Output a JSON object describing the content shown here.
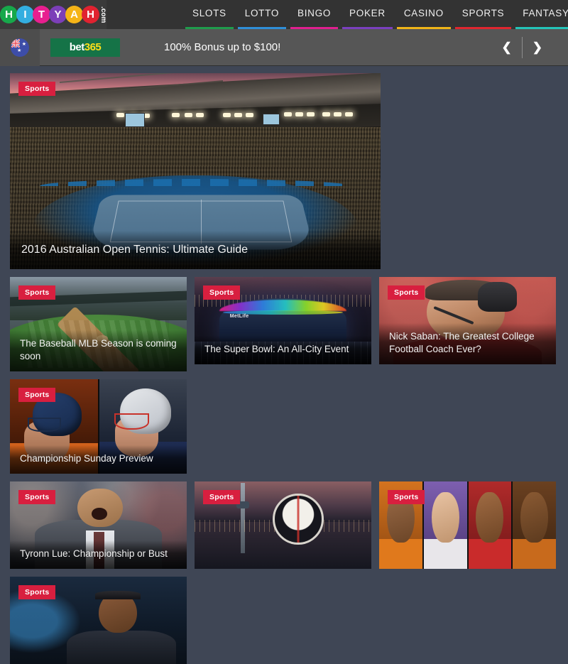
{
  "site": {
    "logo_letters": [
      {
        "char": "H",
        "color": "#17a84b"
      },
      {
        "char": "I",
        "color": "#33aee0"
      },
      {
        "char": "T",
        "color": "#e81f8f"
      },
      {
        "char": "Y",
        "color": "#7c3fb8"
      },
      {
        "char": "A",
        "color": "#f5b417"
      },
      {
        "char": "H",
        "color": "#e02230"
      }
    ],
    "logo_suffix": ".com"
  },
  "nav": {
    "items": [
      {
        "label": "SLOTS",
        "underline": "#1f9c4c"
      },
      {
        "label": "LOTTO",
        "underline": "#2f8fd8"
      },
      {
        "label": "BINGO",
        "underline": "#e01f8f"
      },
      {
        "label": "POKER",
        "underline": "#7a3fbf"
      },
      {
        "label": "CASINO",
        "underline": "#f0b518"
      },
      {
        "label": "SPORTS",
        "underline": "#e0262f"
      },
      {
        "label": "FANTASY",
        "underline": "#24c4b8"
      }
    ]
  },
  "promo": {
    "flag_icon": "australia-flag-icon",
    "brand_bet": "bet",
    "brand_365": "365",
    "offer_text": "100% Bonus up to $100!",
    "prev_icon": "chevron-left-icon",
    "next_icon": "chevron-right-icon"
  },
  "badge_label": "Sports",
  "cards": [
    {
      "id": "hero-tennis",
      "title": "2016 Australian Open Tennis: Ultimate Guide"
    },
    {
      "id": "baseball-mlb",
      "title": "The Baseball MLB Season is coming soon"
    },
    {
      "id": "championship",
      "title": "Championship Sunday Preview"
    },
    {
      "id": "super-bowl",
      "title": "The Super Bowl: An All-City Event"
    },
    {
      "id": "nick-saban",
      "title": "Nick Saban: The Greatest College Football Coach Ever?"
    },
    {
      "id": "tyronn-lue",
      "title": "Tyronn Lue: Championship or Bust"
    },
    {
      "id": "nba-all-star",
      "title": ""
    },
    {
      "id": "nba-players",
      "title": ""
    },
    {
      "id": "serena-tennis",
      "title": ""
    }
  ],
  "colors": {
    "page_bg": "#3f4655",
    "header_bg": "#333333",
    "promo_bg": "#565656",
    "badge_bg": "#d81f3f",
    "bet365_green": "#157347",
    "bet365_yellow": "#ffdf1b"
  }
}
